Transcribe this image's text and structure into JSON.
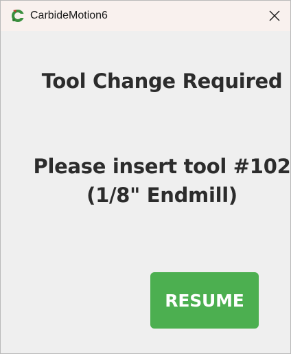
{
  "window": {
    "title": "CarbideMotion6",
    "app_icon": "carbide-motion-icon",
    "close_icon": "close-icon"
  },
  "dialog": {
    "heading": "Tool Change Required",
    "message_line1": "Please insert tool #102",
    "message_line2": "(1/8\" Endmill)",
    "resume_label": "RESUME"
  },
  "colors": {
    "accent": "#4caf50",
    "titlebar": "#f9f1ee",
    "background": "#efefef",
    "text": "#2c2c2c"
  }
}
